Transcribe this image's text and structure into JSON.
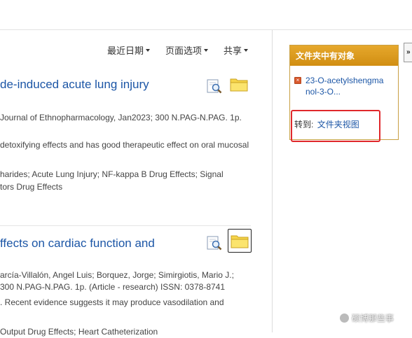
{
  "toolbar": {
    "recent_dates": "最近日期",
    "page_options": "页面选项",
    "share": "共享"
  },
  "results": [
    {
      "title": "de-induced acute lung injury",
      "lines": [
        "Journal of Ethnopharmacology, Jan2023; 300 N.PAG-N.PAG. 1p.",
        "detoxifying effects and has good therapeutic effect on oral mucosal",
        "harides; Acute Lung Injury; NF-kappa B Drug Effects; Signal",
        "tors Drug Effects"
      ]
    },
    {
      "title": "ffects on cardiac function and",
      "lines": [
        "arcía-Villalón, Angel Luis; Borquez, Jorge; Simirgiotis, Mario J.;",
        "300 N.PAG-N.PAG. 1p. (Article - research) ISSN: 0378-8741",
        ". Recent evidence suggests it may produce vasodilation and",
        "Output Drug Effects; Heart Catheterization"
      ]
    }
  ],
  "folder_panel": {
    "heading": "文件夹中有对象",
    "item_title": "23-O-acetylshengmanol-3-O...",
    "goto_label": "转到:",
    "goto_link": "文件夹视图"
  },
  "collapse_label": "»",
  "watermark": "硕博那些事",
  "colors": {
    "link": "#1c56a6",
    "panel_header": "#d99a1e",
    "highlight": "#e0282c"
  }
}
